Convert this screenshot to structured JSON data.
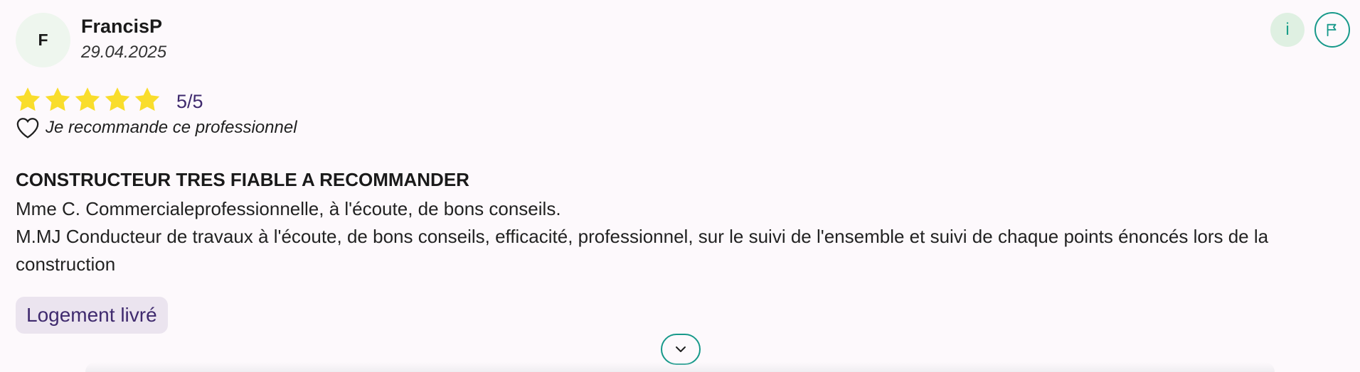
{
  "author": {
    "initial": "F",
    "name": "FrancisP",
    "date": "29.04.2025"
  },
  "actions": {
    "info_label": "i",
    "report_icon": "flag-icon"
  },
  "rating": {
    "value": 5,
    "max": 5,
    "text": "5/5",
    "star_color": "#f9dd2c"
  },
  "recommend": {
    "icon": "heart-icon",
    "text": "Je recommande ce professionnel"
  },
  "review": {
    "title": "CONSTRUCTEUR TRES FIABLE A RECOMMANDER",
    "lines": [
      "Mme C. Commercialeprofessionnelle, à l'écoute, de bons conseils.",
      "M.MJ Conducteur de travaux à l'écoute, de bons conseils, efficacité, professionnel, sur le suivi de l'ensemble et suivi de chaque points énoncés lors de la construction"
    ]
  },
  "tag": {
    "label": "Logement livré"
  },
  "expand": {
    "icon": "chevron-down-icon"
  },
  "colors": {
    "accent": "#17998a",
    "tag_text": "#3f2a6e",
    "background": "#fdf9fc"
  }
}
